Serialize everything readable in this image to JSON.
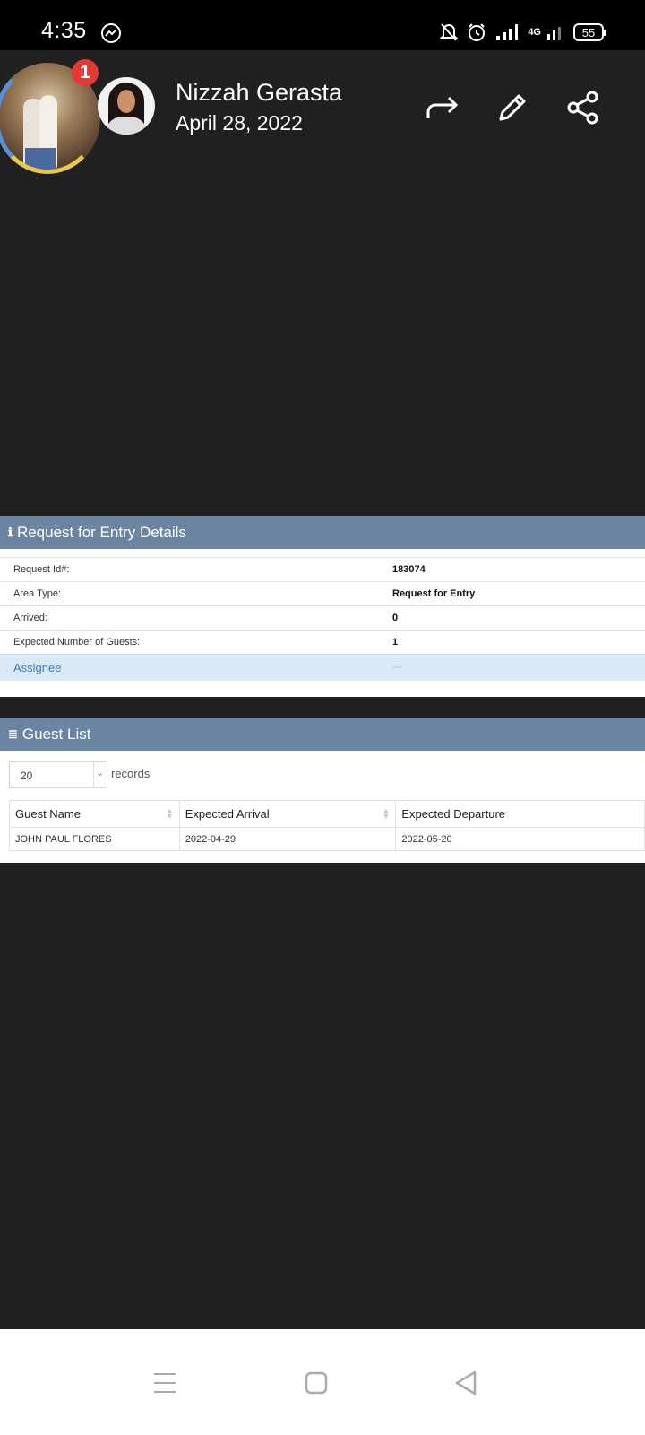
{
  "status_bar": {
    "time": "4:35",
    "network": "4G",
    "battery": "55"
  },
  "header": {
    "chat_badge_count": "1",
    "sender_name": "Nizzah Gerasta",
    "post_date": "April 28, 2022"
  },
  "entry_details": {
    "title": "Request for Entry Details",
    "rows": [
      {
        "label": "Request Id#:",
        "value": "183074"
      },
      {
        "label": "Area Type:",
        "value": "Request for Entry"
      },
      {
        "label": "Arrived:",
        "value": "0"
      },
      {
        "label": "Expected Number of Guests:",
        "value": "1"
      },
      {
        "label": "Assignee",
        "value": "---"
      }
    ]
  },
  "guest_list": {
    "title": "Guest List",
    "page_size": "20",
    "records_label": "records",
    "columns": [
      "Guest Name",
      "Expected Arrival",
      "Expected Departure"
    ],
    "rows": [
      {
        "name": "JOHN PAUL FLORES",
        "arrival": "2022-04-29",
        "departure": "2022-05-20"
      }
    ]
  },
  "colors": {
    "panel_header": "#6b84a2",
    "highlight_row": "#d9eaf6",
    "background": "#202020"
  }
}
